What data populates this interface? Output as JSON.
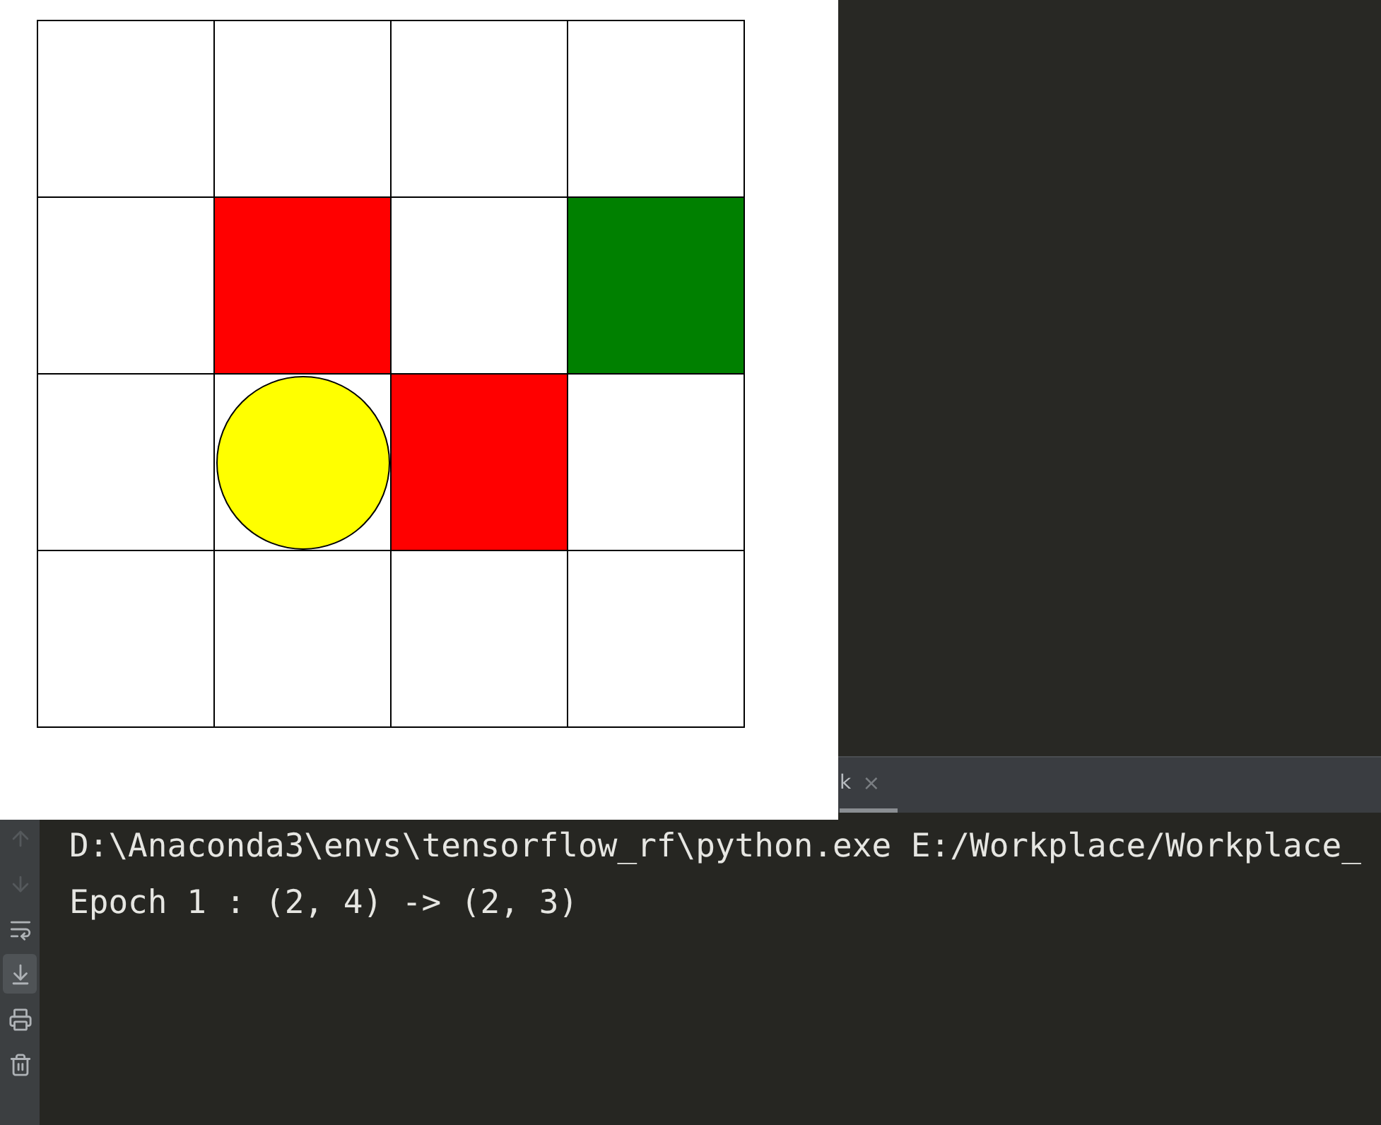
{
  "canvas_window": {
    "grid": [
      [
        {
          "kind": "empty"
        },
        {
          "kind": "empty"
        },
        {
          "kind": "empty"
        },
        {
          "kind": "empty"
        }
      ],
      [
        {
          "kind": "empty"
        },
        {
          "kind": "trap",
          "color": "#ff0000"
        },
        {
          "kind": "empty"
        },
        {
          "kind": "goal",
          "color": "#008000"
        }
      ],
      [
        {
          "kind": "empty"
        },
        {
          "kind": "agent",
          "color": "#ffff00"
        },
        {
          "kind": "trap",
          "color": "#ff0000"
        },
        {
          "kind": "empty"
        }
      ],
      [
        {
          "kind": "empty"
        },
        {
          "kind": "empty"
        },
        {
          "kind": "empty"
        },
        {
          "kind": "empty"
        }
      ]
    ]
  },
  "run_panel": {
    "tab": {
      "label": "k",
      "close": "×",
      "selected": true
    },
    "toolbar": [
      {
        "kind": "up",
        "selected": false,
        "disabled": true
      },
      {
        "kind": "down",
        "selected": false,
        "disabled": true
      },
      {
        "kind": "wrap",
        "selected": false,
        "disabled": false
      },
      {
        "kind": "scroll-end",
        "selected": true,
        "disabled": false
      },
      {
        "kind": "print",
        "selected": false,
        "disabled": false
      },
      {
        "kind": "trash",
        "selected": false,
        "disabled": false
      }
    ],
    "console": [
      "D:\\Anaconda3\\envs\\tensorflow_rf\\python.exe E:/Workplace/Workplace_",
      "Epoch 1 : (2, 4) -> (2, 3)"
    ]
  }
}
